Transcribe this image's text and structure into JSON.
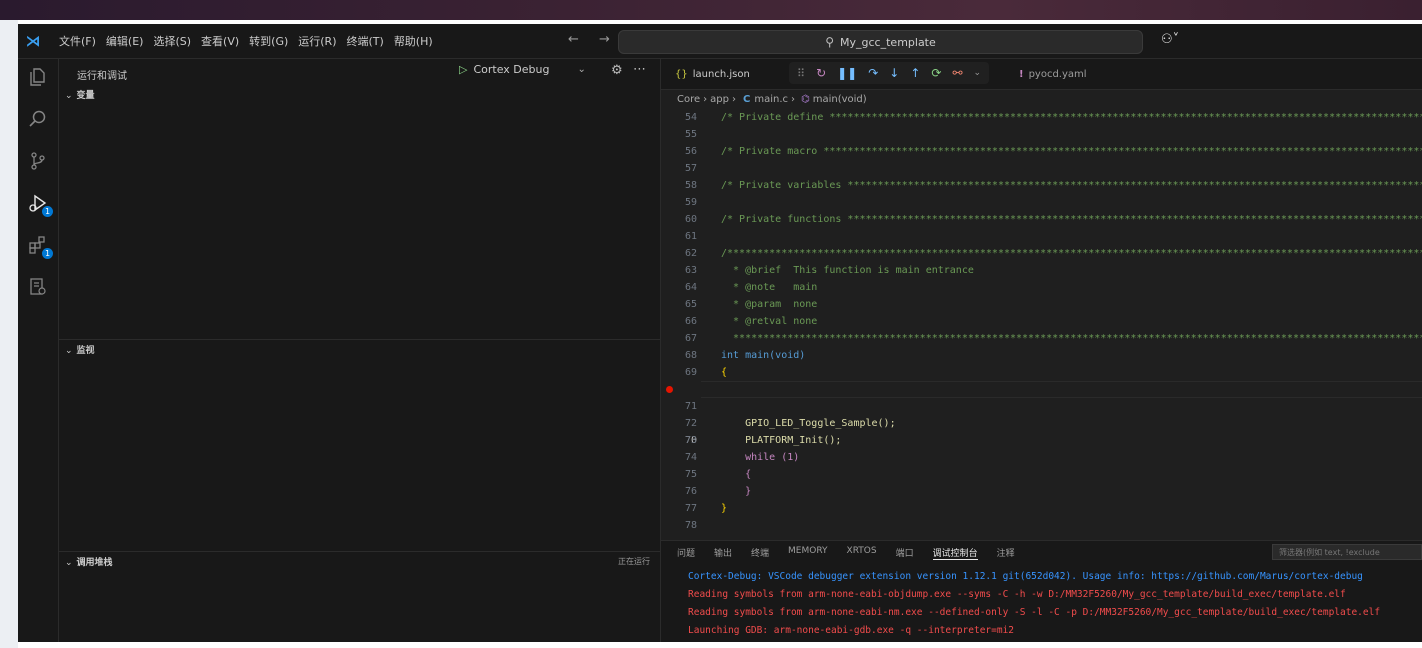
{
  "window": {
    "menu": [
      "文件(F)",
      "编辑(E)",
      "选择(S)",
      "查看(V)",
      "转到(G)",
      "运行(R)",
      "终端(T)",
      "帮助(H)"
    ],
    "nav_arrows": "← →",
    "search_text": "My_gcc_template",
    "copilot": "⚇˅"
  },
  "sidebar": {
    "title": "运行和调试",
    "config_name": "Cortex Debug",
    "sections": [
      {
        "label": "变量"
      },
      {
        "label": "监视"
      },
      {
        "label": "调用堆栈",
        "status": "正在运行"
      }
    ]
  },
  "editor": {
    "tabs": [
      {
        "icon": "{}",
        "label": "launch.json"
      },
      {
        "icon": "!",
        "label": "pyocd.yaml"
      }
    ],
    "breadcrumb": {
      "folder1": "Core",
      "folder2": "app",
      "file_icon": "C",
      "file": "main.c",
      "symbol": "main(void)"
    },
    "code_lines": [
      {
        "n": "54",
        "t": "/* Private define ***************************************************************************************************"
      },
      {
        "n": "55",
        "t": ""
      },
      {
        "n": "56",
        "t": "/* Private macro ****************************************************************************************************"
      },
      {
        "n": "57",
        "t": ""
      },
      {
        "n": "58",
        "t": "/* Private variables ************************************************************************************************"
      },
      {
        "n": "59",
        "t": ""
      },
      {
        "n": "60",
        "t": "/* Private functions ************************************************************************************************"
      },
      {
        "n": "61",
        "t": ""
      },
      {
        "n": "62",
        "t": "/*********************************************************************************************************************"
      },
      {
        "n": "63",
        "t": "  * @brief  This function is main entrance"
      },
      {
        "n": "64",
        "t": "  * @note   main"
      },
      {
        "n": "65",
        "t": "  * @param  none"
      },
      {
        "n": "66",
        "t": "  * @retval none"
      },
      {
        "n": "67",
        "t": "  *******************************************************************************************************************"
      },
      {
        "n": "68",
        "t": "int main(void)"
      },
      {
        "n": "69",
        "t": "{"
      },
      {
        "n": "70",
        "t": "    PLATFORM_Init();"
      },
      {
        "n": "71",
        "t": ""
      },
      {
        "n": "72",
        "t": "    GPIO_LED_Toggle_Sample();"
      },
      {
        "n": "73",
        "t": ""
      },
      {
        "n": "74",
        "t": "    while (1)"
      },
      {
        "n": "75",
        "t": "    {"
      },
      {
        "n": "76",
        "t": "    }"
      },
      {
        "n": "77",
        "t": "}"
      },
      {
        "n": "78",
        "t": ""
      }
    ]
  },
  "panel": {
    "tabs": [
      "问题",
      "输出",
      "终端",
      "MEMORY",
      "XRTOS",
      "端口",
      "调试控制台",
      "注释"
    ],
    "active_tab": "调试控制台",
    "filter_placeholder": "筛选器(例如 text, !exclude",
    "lines": [
      "Cortex-Debug: VSCode debugger extension version 1.12.1 git(652d042). Usage info: https://github.com/Marus/cortex-debug",
      "Reading symbols from arm-none-eabi-objdump.exe --syms -C -h -w D:/MM32F5260/My_gcc_template/build_exec/template.elf",
      "Reading symbols from arm-none-eabi-nm.exe --defined-only -S -l -C -p D:/MM32F5260/My_gcc_template/build_exec/template.elf",
      "Launching GDB: arm-none-eabi-gdb.exe -q --interpreter=mi2"
    ]
  },
  "colors": {
    "accent": "#0078d4",
    "breakpoint": "#e51400",
    "comment": "#6a9955"
  }
}
